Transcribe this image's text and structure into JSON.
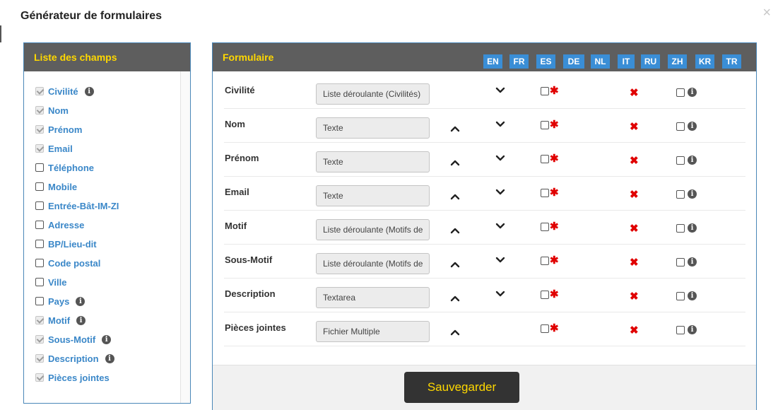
{
  "modal": {
    "title": "Générateur de formulaires",
    "close": "×"
  },
  "field_list": {
    "title": "Liste des champs",
    "items": [
      {
        "label": "Civilité",
        "checked": true,
        "disabled": true,
        "info": true
      },
      {
        "label": "Nom",
        "checked": true,
        "disabled": true,
        "info": false
      },
      {
        "label": "Prénom",
        "checked": true,
        "disabled": true,
        "info": false
      },
      {
        "label": "Email",
        "checked": true,
        "disabled": true,
        "info": false
      },
      {
        "label": "Téléphone",
        "checked": false,
        "disabled": false,
        "info": false
      },
      {
        "label": "Mobile",
        "checked": false,
        "disabled": false,
        "info": false
      },
      {
        "label": "Entrée-Bât-IM-ZI",
        "checked": false,
        "disabled": false,
        "info": false
      },
      {
        "label": "Adresse",
        "checked": false,
        "disabled": false,
        "info": false
      },
      {
        "label": "BP/Lieu-dit",
        "checked": false,
        "disabled": false,
        "info": false
      },
      {
        "label": "Code postal",
        "checked": false,
        "disabled": false,
        "info": false
      },
      {
        "label": "Ville",
        "checked": false,
        "disabled": false,
        "info": false
      },
      {
        "label": "Pays",
        "checked": false,
        "disabled": false,
        "info": true
      },
      {
        "label": "Motif",
        "checked": true,
        "disabled": true,
        "info": true
      },
      {
        "label": "Sous-Motif",
        "checked": true,
        "disabled": true,
        "info": true
      },
      {
        "label": "Description",
        "checked": true,
        "disabled": true,
        "info": true
      },
      {
        "label": "Pièces jointes",
        "checked": true,
        "disabled": true,
        "info": false
      }
    ]
  },
  "form": {
    "title": "Formulaire",
    "languages": [
      "EN",
      "FR",
      "ES",
      "DE",
      "NL",
      "IT",
      "RU",
      "ZH",
      "KR",
      "TR"
    ],
    "rows": [
      {
        "label": "Civilité",
        "type": "Liste déroulante (Civilités)",
        "up": false,
        "down": true
      },
      {
        "label": "Nom",
        "type": "Texte",
        "up": true,
        "down": true
      },
      {
        "label": "Prénom",
        "type": "Texte",
        "up": true,
        "down": true
      },
      {
        "label": "Email",
        "type": "Texte",
        "up": true,
        "down": true
      },
      {
        "label": "Motif",
        "type": "Liste déroulante (Motifs de",
        "up": true,
        "down": true
      },
      {
        "label": "Sous-Motif",
        "type": "Liste déroulante (Motifs de",
        "up": true,
        "down": true
      },
      {
        "label": "Description",
        "type": "Textarea",
        "up": true,
        "down": true
      },
      {
        "label": "Pièces jointes",
        "type": "Fichier Multiple",
        "up": true,
        "down": false
      }
    ],
    "save_label": "Sauvegarder"
  },
  "colors": {
    "accent_yellow": "#ffd800",
    "header_gray": "#5e5e5e",
    "link_blue": "#3a87c8",
    "lang_blue": "#3a8ed6",
    "required_red": "#e00000"
  },
  "icons": {
    "info": "info-circle-icon",
    "required": "asterisk-icon",
    "delete": "cross-icon",
    "move_up": "chevron-up-icon",
    "move_down": "chevron-down-icon",
    "close": "close-icon"
  }
}
